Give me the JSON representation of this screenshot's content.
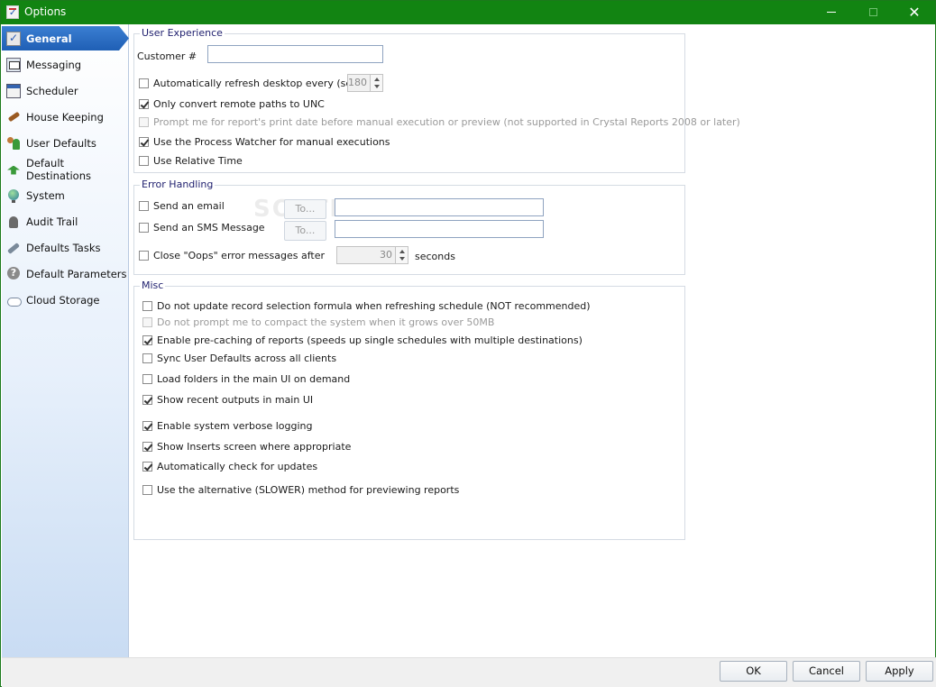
{
  "window": {
    "title": "Options"
  },
  "sidebar": {
    "items": [
      {
        "label": "General",
        "icon": "general-icon",
        "active": true
      },
      {
        "label": "Messaging",
        "icon": "messaging-icon"
      },
      {
        "label": "Scheduler",
        "icon": "calendar-icon"
      },
      {
        "label": "House Keeping",
        "icon": "broom-icon"
      },
      {
        "label": "User Defaults",
        "icon": "users-icon"
      },
      {
        "label": "Default Destinations",
        "icon": "destination-arrow-icon"
      },
      {
        "label": "System",
        "icon": "globe-icon"
      },
      {
        "label": "Audit Trail",
        "icon": "audit-icon"
      },
      {
        "label": "Defaults Tasks",
        "icon": "tools-icon"
      },
      {
        "label": "Default Parameters",
        "icon": "help-icon"
      },
      {
        "label": "Cloud Storage",
        "icon": "cloud-icon"
      }
    ]
  },
  "user_experience": {
    "group_label": "User Experience",
    "customer_label": "Customer #",
    "customer_value": "",
    "auto_refresh": {
      "label": "Automatically refresh desktop every (secs)",
      "checked": false,
      "value": "180"
    },
    "only_convert": {
      "label": "Only convert remote paths to UNC",
      "checked": true
    },
    "prompt_print_date": {
      "label": "Prompt me for report's print date before manual execution or preview (not supported in Crystal Reports 2008 or later)",
      "checked": false,
      "disabled": true
    },
    "process_watcher": {
      "label": "Use the Process Watcher for manual executions",
      "checked": true
    },
    "relative_time": {
      "label": "Use Relative Time",
      "checked": false
    }
  },
  "error_handling": {
    "group_label": "Error Handling",
    "send_email": {
      "label": "Send an email",
      "checked": false,
      "to_label": "To...",
      "value": ""
    },
    "send_sms": {
      "label": "Send an SMS Message",
      "checked": false,
      "to_label": "To...",
      "value": ""
    },
    "close_oops": {
      "label": "Close \"Oops\" error messages after",
      "checked": false,
      "value": "30",
      "unit": "seconds"
    }
  },
  "misc": {
    "group_label": "Misc",
    "items": [
      {
        "label": "Do not update record selection formula when refreshing schedule (NOT recommended)",
        "checked": false
      },
      {
        "label": "Do not prompt me to compact the system when it grows over 50MB",
        "checked": false,
        "disabled": true
      },
      {
        "label": "Enable pre-caching of reports (speeds up single schedules with multiple destinations)",
        "checked": true
      },
      {
        "label": "Sync User Defaults across all clients",
        "checked": false
      },
      {
        "label": "Load folders in the main UI on demand",
        "checked": false
      },
      {
        "label": "Show recent outputs in main UI",
        "checked": true
      },
      {
        "label": "Enable system verbose logging",
        "checked": true
      },
      {
        "label": "Show Inserts screen where appropriate",
        "checked": true
      },
      {
        "label": "Automatically check for updates",
        "checked": true
      },
      {
        "label": "Use the alternative (SLOWER) method for previewing reports",
        "checked": false
      }
    ]
  },
  "watermark": "SOFTPEDIA",
  "footer": {
    "ok": "OK",
    "cancel": "Cancel",
    "apply": "Apply"
  }
}
